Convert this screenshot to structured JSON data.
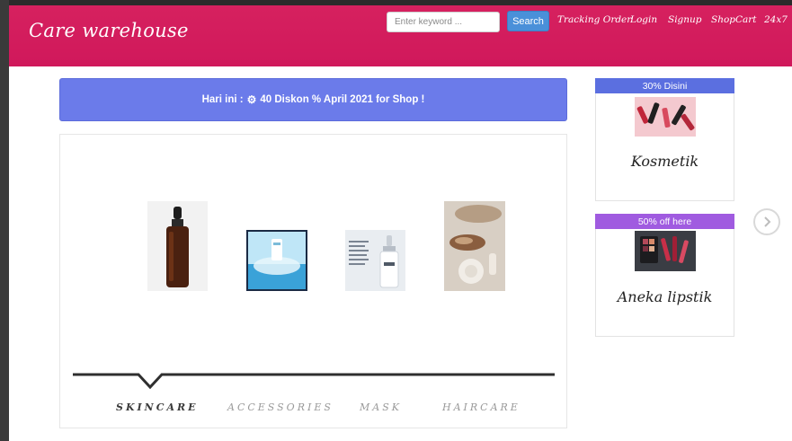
{
  "header": {
    "brand": "Care warehouse",
    "search": {
      "placeholder": "Enter keyword ...",
      "button_label": "Search"
    },
    "nav": [
      "Tracking Order",
      "Login",
      "Signup",
      "ShopCart",
      "24x7"
    ]
  },
  "promo": {
    "prefix": "Hari ini :",
    "text": "40 Diskon % April 2021 for Shop !",
    "icon": "gear-icon"
  },
  "products": [
    {
      "name": "serum-bottle",
      "icon": "serum-bottle-image"
    },
    {
      "name": "product-box",
      "icon": "product-box-image"
    },
    {
      "name": "pore-serum",
      "icon": "pore-serum-image"
    },
    {
      "name": "skincare-flatlay",
      "icon": "skincare-flatlay-image"
    }
  ],
  "tabs": [
    "SKINCARE",
    "ACCESSORIES",
    "MASK",
    "HAIRCARE"
  ],
  "active_tab": "SKINCARE",
  "side_cards": [
    {
      "badge": "30% Disini",
      "title": "Kosmetik",
      "badge_color": "#5b6fe0",
      "image": "lipstick-image"
    },
    {
      "badge": "50% off here",
      "title": "Aneka lipstik",
      "badge_color": "#a05be0",
      "image": "makeup-palette-image"
    }
  ],
  "colors": {
    "navbar": "#d81b60",
    "promo": "#6b7bea",
    "search_button": "#4a90d9"
  }
}
